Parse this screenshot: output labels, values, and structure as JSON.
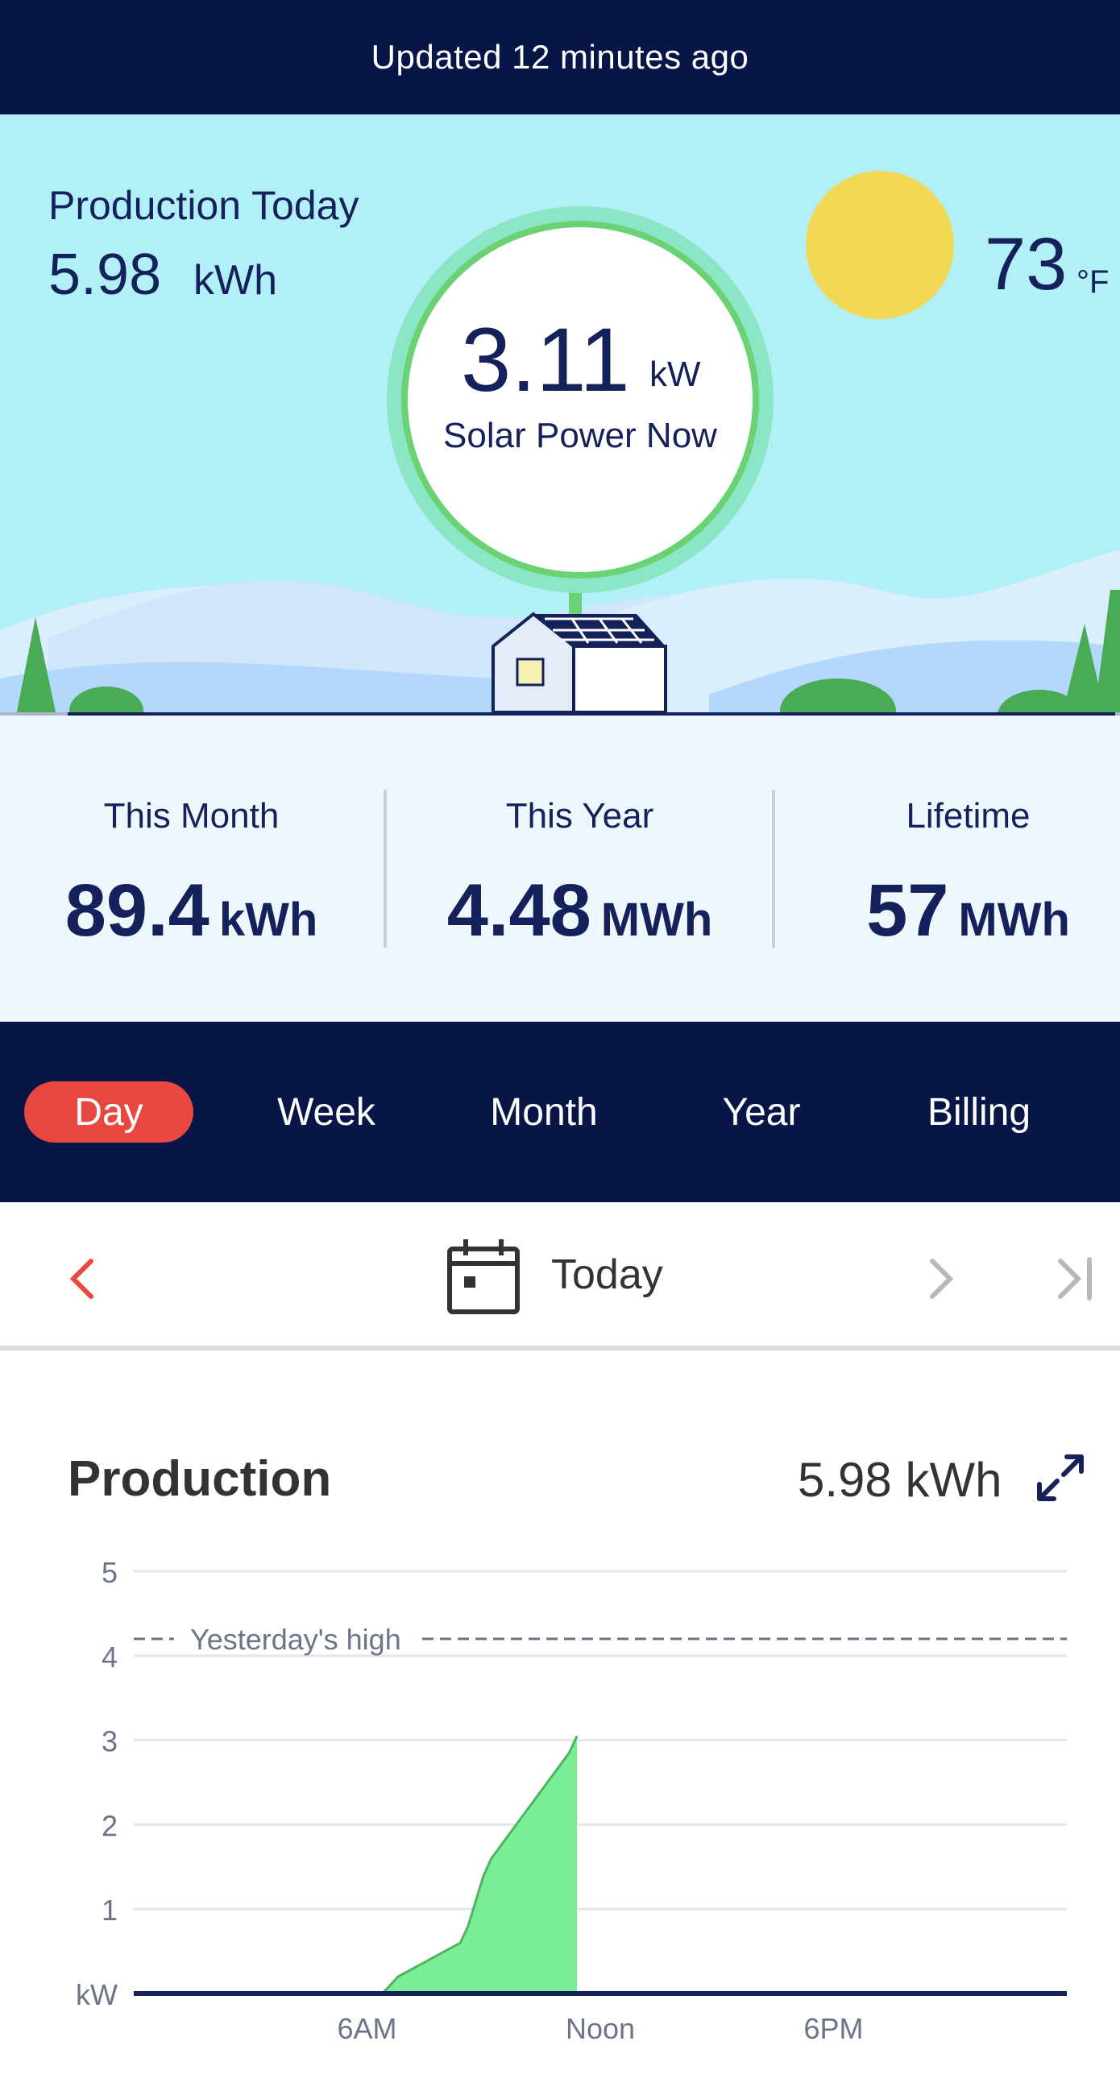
{
  "status": {
    "updated_text": "Updated 12 minutes ago"
  },
  "hero": {
    "production_today_label": "Production Today",
    "production_today_value": "5.98",
    "production_today_unit": "kWh",
    "power_now_value": "3.11",
    "power_now_unit": "kW",
    "power_now_label": "Solar Power Now",
    "temperature_value": "73",
    "temperature_unit": "°F",
    "sun_icon": "sun-icon",
    "house_icon": "house-with-solar-panels-icon"
  },
  "stats": [
    {
      "label": "This Month",
      "value": "89.4",
      "unit": "kWh"
    },
    {
      "label": "This Year",
      "value": "4.48",
      "unit": "MWh"
    },
    {
      "label": "Lifetime",
      "value": "57",
      "unit": "MWh"
    }
  ],
  "period_tabs": {
    "items": [
      "Day",
      "Week",
      "Month",
      "Year",
      "Billing"
    ],
    "active": "Day"
  },
  "date_nav": {
    "label": "Today",
    "prev_icon": "chevron-left-icon",
    "next_icon": "chevron-right-icon",
    "last_icon": "skip-to-end-icon",
    "calendar_icon": "calendar-icon"
  },
  "production": {
    "title": "Production",
    "total": "5.98 kWh",
    "expand_icon": "expand-icon"
  },
  "colors": {
    "navy": "#071646",
    "accent_red": "#e8483f",
    "sky": "#b2f0f8",
    "production_fill": "#79ee97",
    "production_line": "#4fb45f"
  },
  "chart_data": {
    "type": "area",
    "title": "Production",
    "xlabel": "",
    "ylabel": "kW",
    "yticks": [
      "kW",
      "1",
      "2",
      "3",
      "4",
      "5"
    ],
    "ylim": [
      0,
      5
    ],
    "xlim": [
      0,
      24
    ],
    "xticks": [
      {
        "x": 6,
        "label": "6AM"
      },
      {
        "x": 12,
        "label": "Noon"
      },
      {
        "x": 18,
        "label": "6PM"
      }
    ],
    "reference_line": {
      "label": "Yesterday's high",
      "value": 4.2
    },
    "series": [
      {
        "x": [
          5.8,
          6.4,
          6.6,
          6.8,
          7.2,
          7.6,
          8.0,
          8.4,
          8.6,
          8.8,
          9.0,
          9.2,
          9.6,
          10.0,
          10.4,
          10.8,
          11.2,
          11.4,
          11.4
        ],
        "values": [
          0,
          0,
          0.1,
          0.2,
          0.3,
          0.4,
          0.5,
          0.6,
          0.8,
          1.1,
          1.4,
          1.6,
          1.85,
          2.1,
          2.35,
          2.6,
          2.85,
          3.05,
          0
        ]
      }
    ],
    "grid": true
  }
}
